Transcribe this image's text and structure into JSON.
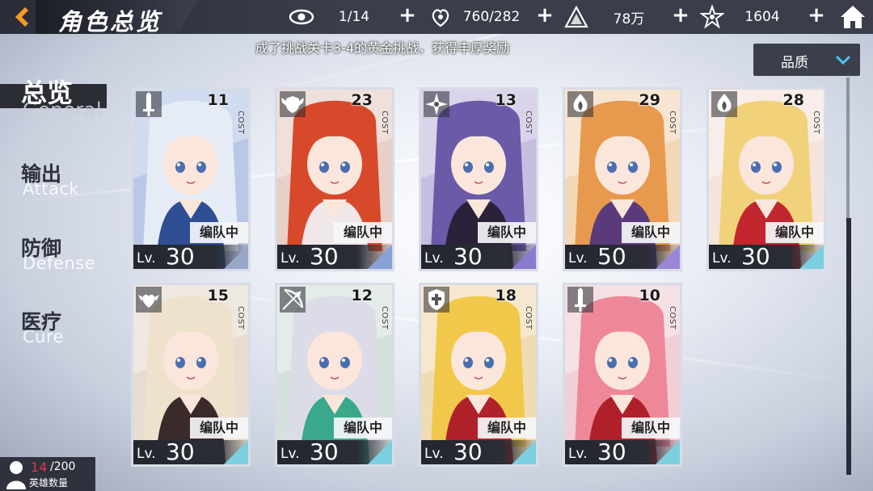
{
  "header": {
    "title": "角色总览",
    "resources": [
      {
        "icon": "eye-icon",
        "value": "1/14"
      },
      {
        "icon": "stamina-icon",
        "value": "760/282"
      },
      {
        "icon": "gold-pyramid-icon",
        "value": "78万"
      },
      {
        "icon": "star-gem-icon",
        "value": "1604"
      }
    ]
  },
  "notice": "成了挑战关卡3-4的黄金挑战，获得丰厚奖励",
  "sort": {
    "label": "品质"
  },
  "categories": [
    {
      "zh": "总览",
      "en": "General"
    },
    {
      "zh": "输出",
      "en": "Attack"
    },
    {
      "zh": "防御",
      "en": "Defense"
    },
    {
      "zh": "医疗",
      "en": "Cure"
    }
  ],
  "cost_label": "COST",
  "level_prefix": "Lv.",
  "cards": [
    {
      "cost": "11",
      "level": "30",
      "team": "编队中",
      "role_icon": "sword-icon",
      "hair": "#e6ecf5",
      "outfit": "#2f4f94",
      "bg": "#b9c8e6",
      "stripe": "#9aa6c8"
    },
    {
      "cost": "23",
      "level": "30",
      "team": "编队中",
      "role_icon": "winged-shield-icon",
      "hair": "#d8482a",
      "outfit": "#f0e8e8",
      "bg": "#e8cfc8",
      "stripe": "#8aa0d8"
    },
    {
      "cost": "13",
      "level": "30",
      "team": "编队中",
      "role_icon": "shuriken-icon",
      "hair": "#6a5aa8",
      "outfit": "#2a2238",
      "bg": "#c6bedf",
      "stripe": "#8a7ad0"
    },
    {
      "cost": "29",
      "level": "50",
      "team": "编队中",
      "role_icon": "flame-emblem-icon",
      "hair": "#e79a4e",
      "outfit": "#5a3a7a",
      "bg": "#f3d8b8",
      "stripe": "#9a86d8"
    },
    {
      "cost": "28",
      "level": "30",
      "team": "编队中",
      "role_icon": "flame-emblem-icon",
      "hair": "#f1d27a",
      "outfit": "#c2262e",
      "bg": "#f4e4dc",
      "stripe": "#7ad0e0"
    },
    {
      "cost": "15",
      "level": "30",
      "team": "编队中",
      "role_icon": "winged-heart-icon",
      "hair": "#efe2cc",
      "outfit": "#3a2a2a",
      "bg": "#e6dcd0",
      "stripe": "#7ad0e0"
    },
    {
      "cost": "12",
      "level": "30",
      "team": "编队中",
      "role_icon": "bow-icon",
      "hair": "#dcdce8",
      "outfit": "#3aa88a",
      "bg": "#d4e2dc",
      "stripe": "#7ad0e0"
    },
    {
      "cost": "18",
      "level": "30",
      "team": "编队中",
      "role_icon": "cross-shield-icon",
      "hair": "#f2c84a",
      "outfit": "#b0222a",
      "bg": "#f0dcb4",
      "stripe": "#7ad0e0"
    },
    {
      "cost": "10",
      "level": "30",
      "team": "编队中",
      "role_icon": "sword-icon",
      "hair": "#ee8898",
      "outfit": "#b0202a",
      "bg": "#f0d0d6",
      "stripe": "#7ad0e0"
    }
  ],
  "hero_count": {
    "current": "14",
    "max": "/200",
    "label": "英雄数量"
  }
}
